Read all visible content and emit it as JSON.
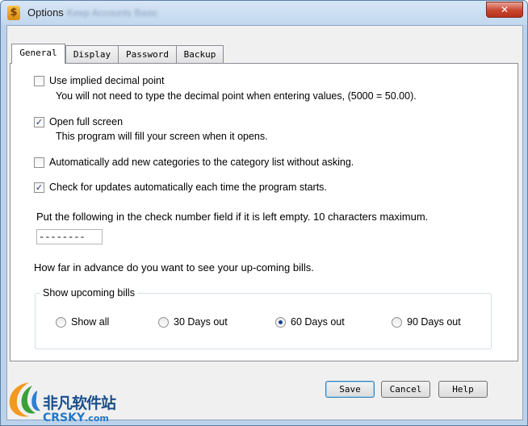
{
  "window": {
    "title": "Options",
    "title_blurred": "Keep Accounts Basic",
    "close_glyph": "✕"
  },
  "tabs": [
    {
      "label": "General",
      "active": true
    },
    {
      "label": "Display",
      "active": false
    },
    {
      "label": "Password",
      "active": false
    },
    {
      "label": "Backup",
      "active": false
    }
  ],
  "general": {
    "implied_decimal": {
      "label": "Use implied decimal point",
      "checked": false,
      "description": "You will not need to type the decimal point when entering values,  (5000 = 50.00)."
    },
    "full_screen": {
      "label": "Open full screen",
      "checked": true,
      "description": "This program will fill your screen when it opens."
    },
    "auto_categories": {
      "label": "Automatically add new categories to the category list without asking.",
      "checked": false
    },
    "check_updates": {
      "label": "Check for updates automatically each time the program starts.",
      "checked": true
    },
    "check_number_prompt": "Put the following in the check number field if it is left empty. 10 characters maximum.",
    "check_number_value": "--------",
    "advance_prompt": "How far in advance do you want to see your up-coming bills.",
    "upcoming": {
      "group_title": "Show upcoming bills",
      "options": [
        {
          "label": "Show all",
          "selected": false
        },
        {
          "label": "30 Days out",
          "selected": false
        },
        {
          "label": "60 Days out",
          "selected": true
        },
        {
          "label": "90 Days out",
          "selected": false
        }
      ]
    }
  },
  "buttons": {
    "save": "Save",
    "cancel": "Cancel",
    "help": "Help"
  },
  "watermark": {
    "cn": "非凡软件站",
    "en": "CRSKY",
    "tld": ".com"
  },
  "glyphs": {
    "check": "✓",
    "app_icon": "$"
  }
}
